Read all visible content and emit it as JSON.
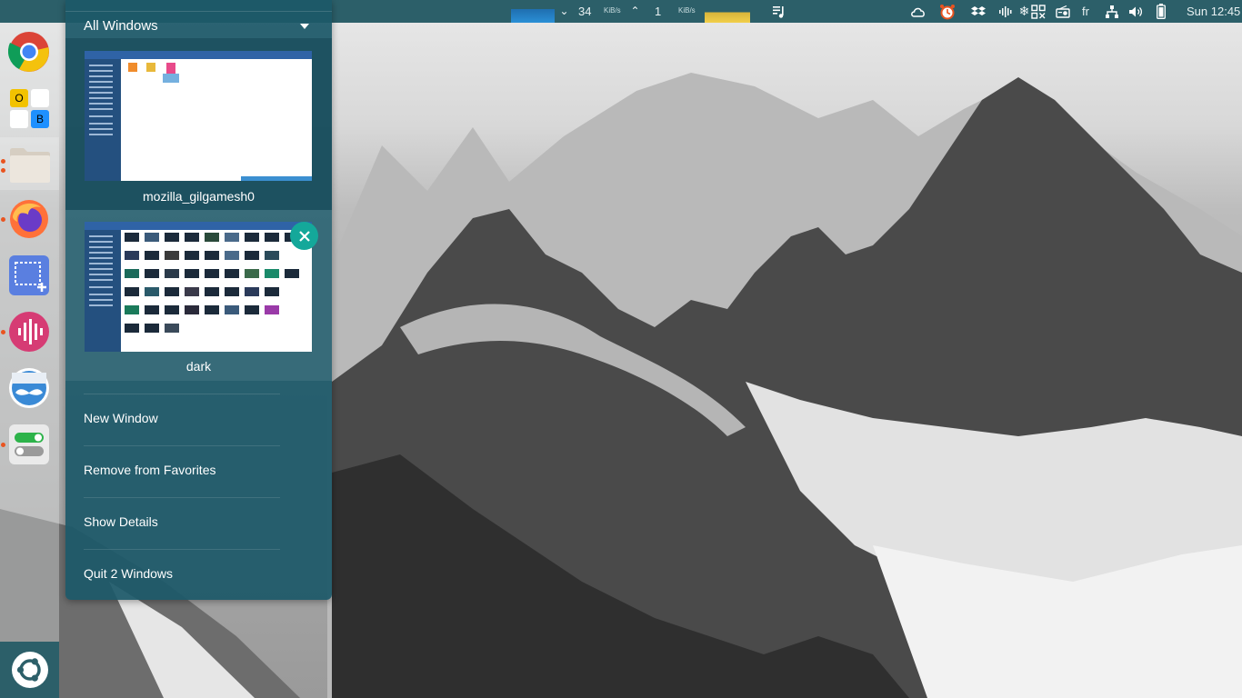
{
  "top_panel": {
    "net_down_value": "34",
    "net_down_unit": "KiB/s",
    "net_up_value": "1",
    "net_up_unit": "KiB/s",
    "language": "fr",
    "clock": "Sun 12:45",
    "icons": [
      "network-down-arrow-icon",
      "network-up-arrow-icon",
      "music-note-icon",
      "cloud-icon",
      "alarm-clock-icon",
      "dropbox-icon",
      "audio-wave-icon",
      "snowflake-icon",
      "workspace-grid-icon",
      "radio-icon",
      "network-icon",
      "volume-icon",
      "battery-icon"
    ]
  },
  "dock": {
    "items": [
      {
        "name": "chrome-icon",
        "running": false
      },
      {
        "name": "office-apps-icon",
        "running": false,
        "letters": [
          "O",
          "B"
        ]
      },
      {
        "name": "files-icon",
        "running": true,
        "active": true
      },
      {
        "name": "firefox-icon",
        "running": true
      },
      {
        "name": "screenshot-icon",
        "running": false
      },
      {
        "name": "audio-recorder-icon",
        "running": true
      },
      {
        "name": "mustache-app-icon",
        "running": false
      },
      {
        "name": "toggle-settings-icon",
        "running": true
      }
    ],
    "show_apps": "ubuntu-logo-icon"
  },
  "popup": {
    "header": "All Windows",
    "windows": [
      {
        "label": "mozilla_gilgamesh0"
      },
      {
        "label": "dark"
      }
    ],
    "menu": [
      {
        "label": "New Window"
      },
      {
        "label": "Remove from Favorites"
      },
      {
        "label": "Show Details"
      },
      {
        "label": "Quit 2 Windows"
      }
    ]
  },
  "colors": {
    "panel": "#2c5f69",
    "popup": "#1c5868",
    "accent_close": "#14a89a",
    "running_dot": "#e95420"
  }
}
